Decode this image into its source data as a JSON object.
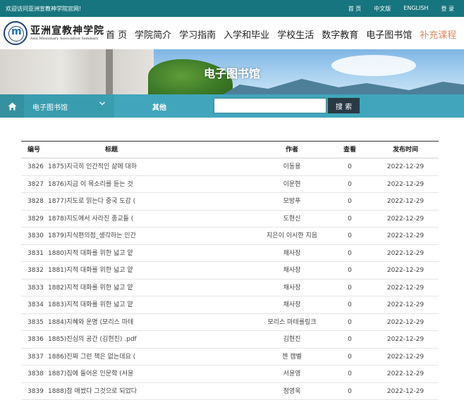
{
  "topbar": {
    "welcome": "欢迎访问亚洲宣教神学院官网!",
    "links": [
      "首 页",
      "中文版",
      "ENGLISH",
      "登 录"
    ]
  },
  "logo": {
    "name_cn": "亚洲宣教神学院",
    "name_en": "Asia Missionary Association Seminary"
  },
  "nav": {
    "items": [
      "首 页",
      "学院简介",
      "学习指南",
      "入学和毕业",
      "学校生活",
      "数字教育",
      "电子图书馆",
      "补充课程"
    ],
    "active_index": 7
  },
  "banner": {
    "title": "电子图书馆"
  },
  "subbar": {
    "select_value": "电子图书馆",
    "other_label": "其他",
    "search_placeholder": "",
    "search_button": "搜 索"
  },
  "table": {
    "columns": [
      "编号",
      "标题",
      "作者",
      "查看",
      "发布时间"
    ],
    "rows": [
      {
        "no": "3826",
        "title": "1875)지극히 인간적인 삶에 대하",
        "author": "이동용",
        "views": "0",
        "date": "2022-12-29"
      },
      {
        "no": "3827",
        "title": "1876)지금 이 목소리를 듣는 것",
        "author": "이운현",
        "views": "0",
        "date": "2022-12-29"
      },
      {
        "no": "3828",
        "title": "1877)지도로 읽는다 중국 도감 (",
        "author": "모방푸",
        "views": "0",
        "date": "2022-12-29"
      },
      {
        "no": "3829",
        "title": "1878)지도에서 사라진 종교들 (",
        "author": "도현신",
        "views": "0",
        "date": "2022-12-29"
      },
      {
        "no": "3830",
        "title": "1879)지식편의점_생각하는 인간",
        "author": "지은이 이시한 지음",
        "views": "0",
        "date": "2022-12-29"
      },
      {
        "no": "3831",
        "title": "1880)지적 대화를 위한 넓고 얕",
        "author": "채사장",
        "views": "0",
        "date": "2022-12-29"
      },
      {
        "no": "3832",
        "title": "1881)지적 대화를 위한 넓고 얕",
        "author": "채사장",
        "views": "0",
        "date": "2022-12-29"
      },
      {
        "no": "3833",
        "title": "1882)지적 대화를 위한 넓고 얕",
        "author": "채사장",
        "views": "0",
        "date": "2022-12-29"
      },
      {
        "no": "3834",
        "title": "1883)지적 대화를 위한 넓고 얕",
        "author": "채사장",
        "views": "0",
        "date": "2022-12-29"
      },
      {
        "no": "3835",
        "title": "1884)지혜와 운명 (모리스 마테",
        "author": "모리스 마테를링크",
        "views": "0",
        "date": "2022-12-29"
      },
      {
        "no": "3836",
        "title": "1885)진심의 공간 (김현진) .pdf",
        "author": "김현진",
        "views": "0",
        "date": "2022-12-29"
      },
      {
        "no": "3837",
        "title": "1886)진짜 그런 책은 없는데요 (",
        "author": "젠 캠벨",
        "views": "0",
        "date": "2022-12-29"
      },
      {
        "no": "3838",
        "title": "1887)집에 들어온 인문학 (서윤",
        "author": "서윤영",
        "views": "0",
        "date": "2022-12-29"
      },
      {
        "no": "3839",
        "title": "1888)참 애썼다 그것으로 되었다",
        "author": "정영욱",
        "views": "0",
        "date": "2022-12-29"
      }
    ]
  },
  "colors": {
    "topbar": "#17757f",
    "subbar": "#41a6bb",
    "nav_active": "#e2895e",
    "search_button": "#2a3a45"
  }
}
